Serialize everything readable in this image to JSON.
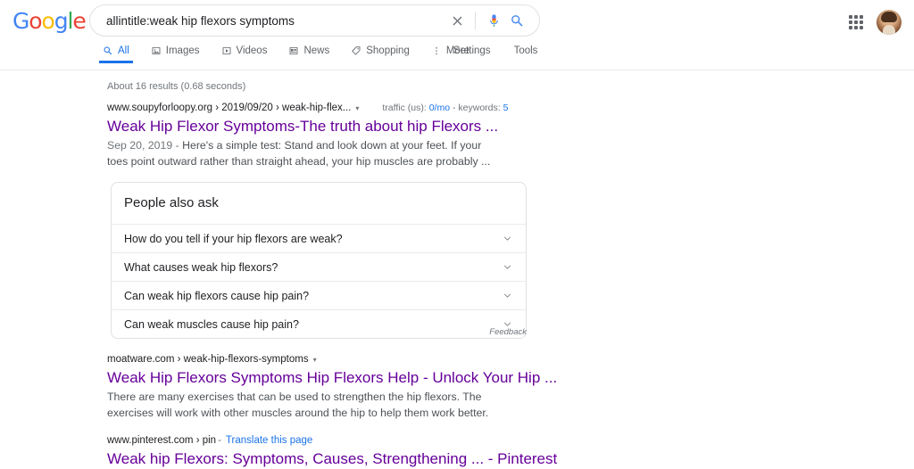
{
  "brand": {
    "logo_letters": [
      "G",
      "o",
      "o",
      "g",
      "l",
      "e"
    ],
    "accent_blue": "#1a73e8",
    "visited_purple": "#660099",
    "muted_gray": "#70757a"
  },
  "search": {
    "value": "allintitle:weak hip flexors symptoms",
    "placeholder": "Search",
    "clear_icon": "close-icon",
    "voice_icon": "microphone-icon",
    "submit_icon": "search-icon"
  },
  "nav": {
    "tabs": [
      {
        "label": "All",
        "icon": "search-icon",
        "active": true
      },
      {
        "label": "Images",
        "icon": "image-icon",
        "active": false
      },
      {
        "label": "Videos",
        "icon": "video-icon",
        "active": false
      },
      {
        "label": "News",
        "icon": "news-icon",
        "active": false
      },
      {
        "label": "Shopping",
        "icon": "tag-icon",
        "active": false
      },
      {
        "label": "More",
        "icon": "more-vertical-icon",
        "active": false
      }
    ],
    "right_links": [
      {
        "label": "Settings"
      },
      {
        "label": "Tools"
      }
    ]
  },
  "header_right": {
    "apps_icon": "apps-grid-icon",
    "avatar": "user-avatar"
  },
  "stats": {
    "text": "About 16 results (0.68 seconds)"
  },
  "results": [
    {
      "url": "www.soupyforloopy.org › 2019/09/20 › weak-hip-flex...",
      "caret": "▾",
      "meta_prefix": "traffic (us): ",
      "meta_value1": "0/mo",
      "meta_middle": " - keywords: ",
      "meta_value2": "5",
      "title": "Weak Hip Flexor Symptoms-The truth about hip Flexors ...",
      "snippet_date": "Sep 20, 2019 - ",
      "snippet": "Here's a simple test: Stand and look down at your feet. If your toes point outward rather than straight ahead, your hip muscles are probably ..."
    },
    {
      "url": "moatware.com › weak-hip-flexors-symptoms",
      "caret": "▾",
      "title": "Weak Hip Flexors Symptoms Hip Flexors Help - Unlock Your Hip ...",
      "snippet": "There are many exercises that can be used to strengthen the hip flexors. The exercises will work with other muscles around the hip to help them work better."
    },
    {
      "url": "www.pinterest.com › pin",
      "separator": "-",
      "translate_label": "Translate this page",
      "title": "Weak hip Flexors: Symptoms, Causes, Strengthening ... - Pinterest"
    }
  ],
  "people_also_ask": {
    "heading": "People also ask",
    "questions": [
      "How do you tell if your hip flexors are weak?",
      "What causes weak hip flexors?",
      "Can weak hip flexors cause hip pain?",
      "Can weak muscles cause hip pain?"
    ],
    "expand_icon": "chevron-down-icon",
    "feedback_label": "Feedback"
  }
}
